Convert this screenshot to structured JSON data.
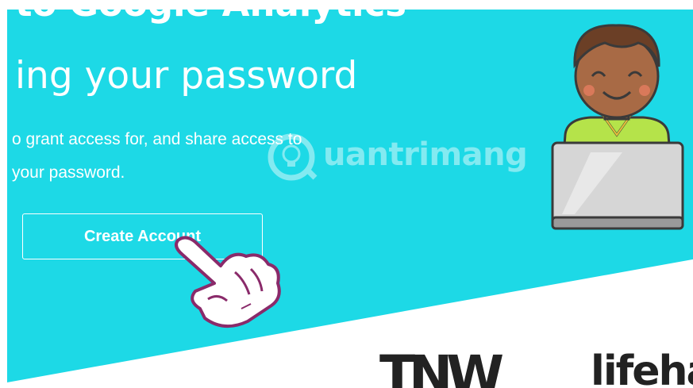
{
  "hero": {
    "headline_line1": "to Google Analytics",
    "headline_line2": "ing your password",
    "subtext_line1": "o grant access for, and share access to",
    "subtext_line2": "your password."
  },
  "cta": {
    "label": "Create Account"
  },
  "watermark": {
    "text": "uantrimang"
  },
  "logos": {
    "tnw": "TNW",
    "lifehacker": "lifeha"
  },
  "colors": {
    "hero_bg": "#1dd9e6",
    "text": "#ffffff",
    "hand_fill": "#ffffff",
    "hand_outline": "#8a2a6a"
  }
}
